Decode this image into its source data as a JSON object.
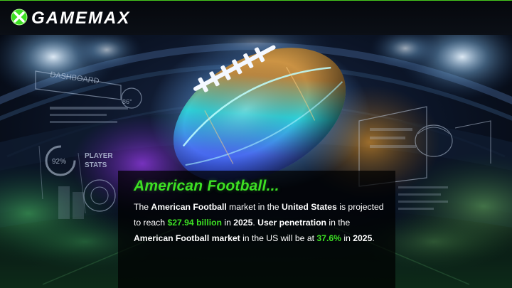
{
  "header": {
    "logo_text": "GAMEMAX",
    "logo_icon": "x-ball-icon"
  },
  "hud": {
    "dashboard_label": "DASHBOARD",
    "degree_label": "86°",
    "ring_percent": "92%",
    "player_stats_line1": "PLAYER",
    "player_stats_line2": "STATS"
  },
  "article": {
    "headline": "American Football...",
    "p1": "The ",
    "p2": "American Football",
    "p3": " market in the ",
    "p4": "United States",
    "p5": " is projected to reach ",
    "p6": "$27.94 billion",
    "p7": " in ",
    "p8": "2025",
    "p9": ". ",
    "p10": "User penetration",
    "p11": " in the ",
    "p12": "American Football market",
    "p13": " in the US will be at ",
    "p14": "37.6%",
    "p15": " in ",
    "p16": "2025",
    "p17": "."
  },
  "colors": {
    "accent_green": "#3de024",
    "text": "#ffffff",
    "header_bg": "#0b0f16"
  }
}
